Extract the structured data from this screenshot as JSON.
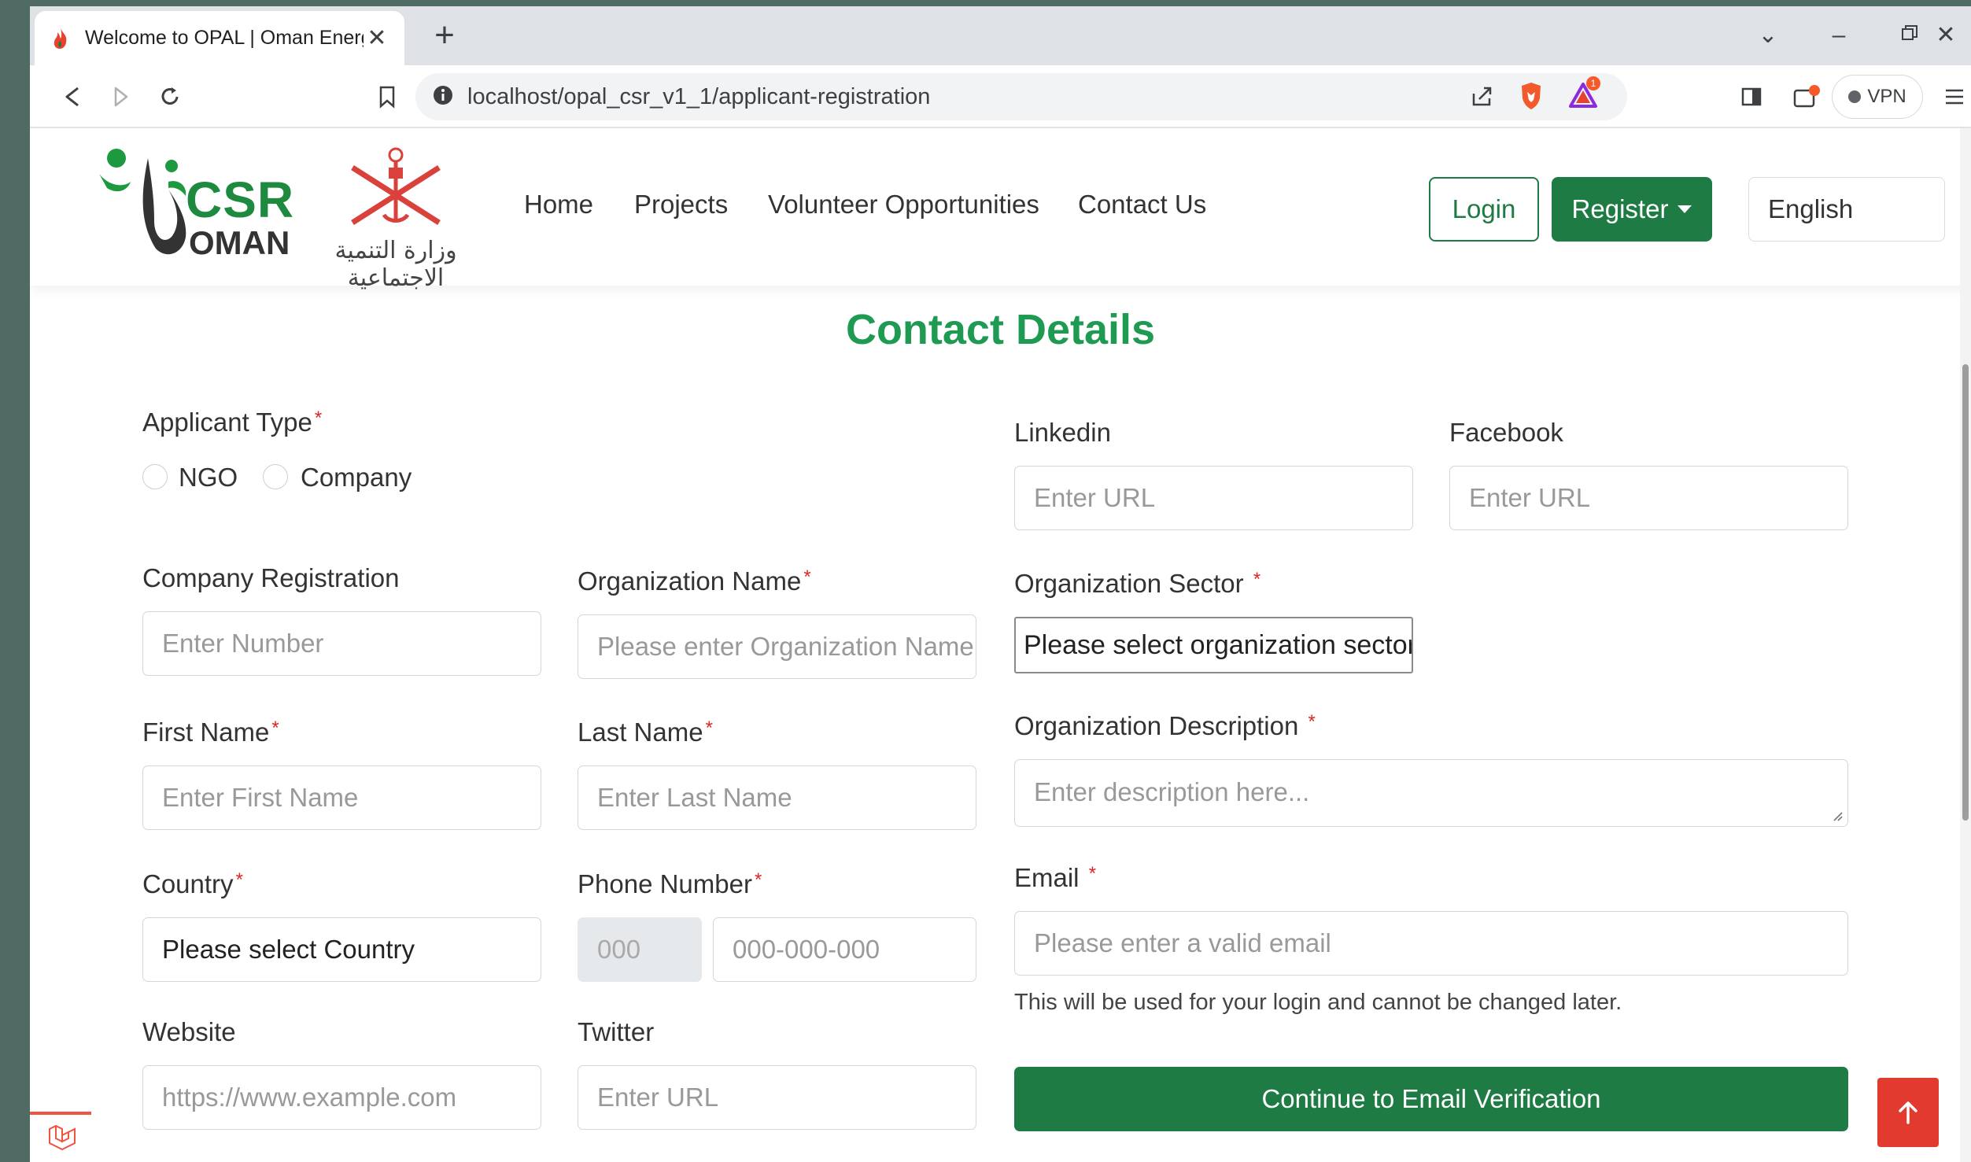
{
  "browser": {
    "tab_title": "Welcome to OPAL | Oman Energy",
    "new_tab_symbol": "+",
    "url": "localhost/opal_csr_v1_1/applicant-registration",
    "vpn_label": "VPN",
    "notification_count": "1"
  },
  "header": {
    "logo_text_top": "CSR",
    "logo_text_bottom": "OMAN",
    "emblem_caption": "وزارة التنمية الاجتماعية",
    "nav": [
      "Home",
      "Projects",
      "Volunteer Opportunities",
      "Contact Us"
    ],
    "login_label": "Login",
    "register_label": "Register",
    "language": "English"
  },
  "form": {
    "title": "Contact Details",
    "applicant_type": {
      "label": "Applicant Type",
      "options": [
        "NGO",
        "Company"
      ]
    },
    "company_registration": {
      "label": "Company Registration",
      "placeholder": "Enter Number"
    },
    "organization_name": {
      "label": "Organization Name",
      "placeholder": "Please enter Organization Name"
    },
    "first_name": {
      "label": "First Name",
      "placeholder": "Enter First Name"
    },
    "last_name": {
      "label": "Last Name",
      "placeholder": "Enter Last Name"
    },
    "country": {
      "label": "Country",
      "value": "Please select Country"
    },
    "phone_number": {
      "label": "Phone Number",
      "prefix": "000",
      "placeholder": "000-000-000"
    },
    "website": {
      "label": "Website",
      "placeholder": "https://www.example.com"
    },
    "twitter": {
      "label": "Twitter",
      "placeholder": "Enter URL"
    },
    "linkedin": {
      "label": "Linkedin",
      "placeholder": "Enter URL"
    },
    "facebook": {
      "label": "Facebook",
      "placeholder": "Enter URL"
    },
    "organization_sector": {
      "label": "Organization Sector",
      "value": "Please select organization sector"
    },
    "organization_description": {
      "label": "Organization Description",
      "placeholder": "Enter description here..."
    },
    "email": {
      "label": "Email",
      "placeholder": "Please enter a valid email",
      "hint": "This will be used for your login and cannot be changed later."
    },
    "required_marker": "*",
    "submit_label": "Continue to Email Verification"
  },
  "colors": {
    "brand_green": "#1d7b43",
    "title_green": "#1f9a52",
    "required_red": "#e02424",
    "back_to_top_red": "#e23a2f"
  },
  "icons": {
    "back_to_top": "arrow-up-icon",
    "scroll_badge": "laravel-icon"
  }
}
